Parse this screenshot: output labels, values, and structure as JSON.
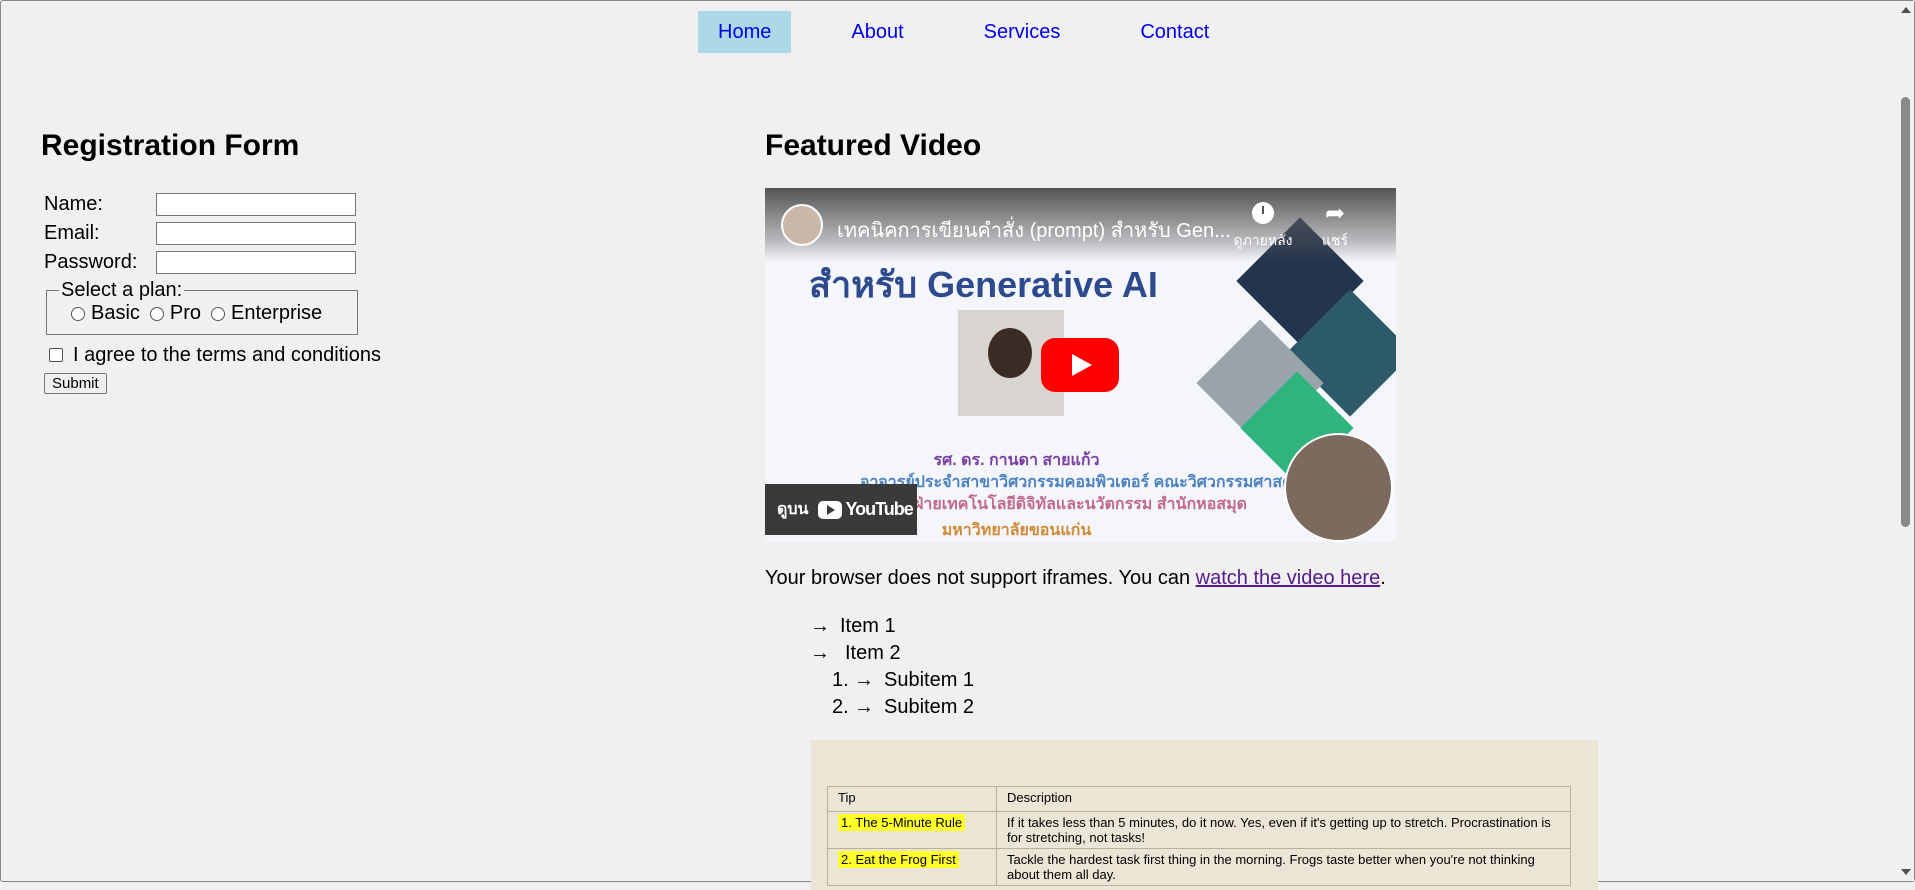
{
  "nav": {
    "items": [
      {
        "label": "Home"
      },
      {
        "label": "About"
      },
      {
        "label": "Services"
      },
      {
        "label": "Contact"
      }
    ]
  },
  "form": {
    "title": "Registration Form",
    "name_label": "Name:",
    "email_label": "Email:",
    "password_label": "Password:",
    "plan_legend": "Select a plan:",
    "plans": [
      "Basic",
      "Pro",
      "Enterprise"
    ],
    "terms_label": "I agree to the terms and conditions",
    "submit_label": "Submit"
  },
  "video": {
    "heading": "Featured Video",
    "title": "เทคนิคการเขียนคำสั่ง (prompt) สำหรับ Gen...",
    "watch_later": "ดูภายหลัง",
    "share": "แชร์",
    "headline": "สำหรับ Generative AI",
    "credit_lines": [
      "รศ. ดร. กานดา สายแก้ว",
      "อาจารย์ประจำสาขาวิศวกรรมคอมพิวเตอร์ คณะวิศวกรรมศาสตร์",
      "ฝ่ายเทคโนโลยีดิจิทัลและนวัตกรรม สำนักหอสมุด",
      "มหาวิทยาลัยขอนแก่น"
    ],
    "watch_on": "ดูบน",
    "youtube": "YouTube"
  },
  "fallback": {
    "text": "Your browser does not support iframes. You can ",
    "link": "watch the video here",
    "end": "."
  },
  "list": {
    "arrow": "→",
    "items": [
      "Item 1",
      "Item 2"
    ],
    "subitems": [
      {
        "num": "1.",
        "label": "Subitem 1"
      },
      {
        "num": "2.",
        "label": "Subitem 2"
      }
    ]
  },
  "tips": {
    "headers": [
      "Tip",
      "Description"
    ],
    "rows": [
      {
        "tip": "1. The 5-Minute Rule",
        "desc": "If it takes less than 5 minutes, do it now. Yes, even if it's getting up to stretch. Procrastination is for stretching, not tasks!"
      },
      {
        "tip": "2. Eat the Frog First",
        "desc": "Tackle the hardest task first thing in the morning. Frogs taste better when you're not thinking about them all day."
      }
    ]
  }
}
